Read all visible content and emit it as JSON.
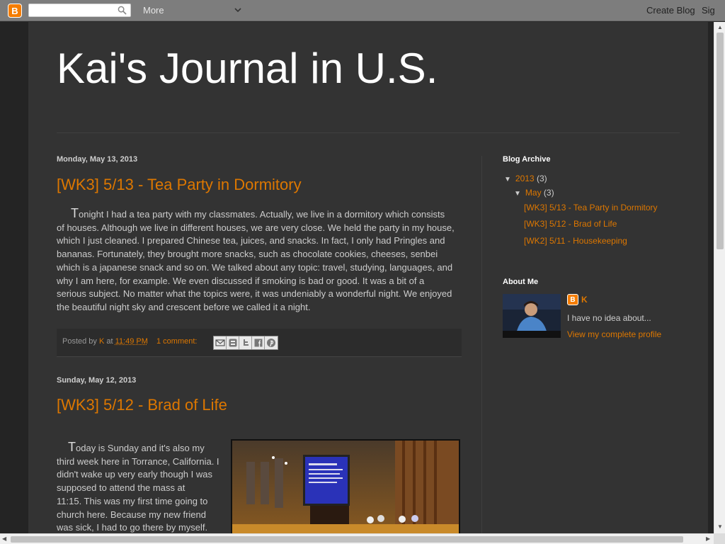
{
  "navbar": {
    "more_label": "More",
    "create_blog": "Create Blog",
    "sign_in": "Sig"
  },
  "blog": {
    "title": "Kai's Journal in U.S."
  },
  "posts": [
    {
      "date": "Monday, May 13, 2013",
      "title": "[WK3] 5/13 - Tea Party in Dormitory",
      "dropcap": "T",
      "lines": [
        "onight I had a tea party with my classmates. Actually, we live in a dormitory which consists",
        "of houses. Although we live in different houses, we are very close. We held the party in my house,",
        "which I just cleaned. I prepared Chinese tea, juices, and snacks. In fact, I only had Pringles and",
        "bananas. Fortunately, they brought more snacks, such as chocolate cookies, cheeses, senbei",
        "which is a japanese snack and so on. We talked about any topic: travel, studying, languages, and",
        "why I am here, for example. We even discussed if smoking is bad or good. It was a bit of a",
        "serious subject. No matter what the topics were, it was undeniably a wonderful night. We enjoyed",
        "the beautiful night sky and crescent before we called it a night."
      ],
      "footer": {
        "posted_by": "Posted by",
        "author": "K",
        "at": "at",
        "time": "11:49 PM",
        "comments": "1 comment:"
      }
    },
    {
      "date": "Sunday, May 12, 2013",
      "title": "[WK3] 5/12 - Brad of Life",
      "dropcap": "T",
      "lines": [
        "oday is Sunday and it's also my",
        "third week here in Torrance, California. I",
        "didn't wake up very early though I was",
        "supposed to attend the mass at",
        "11:15. This was my first time going to",
        "church here. Because my new friend",
        "was sick, I had to go there by myself."
      ]
    }
  ],
  "sidebar": {
    "archive_heading": "Blog Archive",
    "year": "2013",
    "year_count": "(3)",
    "month": "May",
    "month_count": "(3)",
    "archive_posts": [
      "[WK3] 5/13 - Tea Party in Dormitory",
      "[WK3] 5/12 - Brad of Life",
      "[WK2] 5/11 - Housekeeping"
    ],
    "about_heading": "About Me",
    "profile_name": "K",
    "profile_desc": "I have no idea about...",
    "profile_link": "View my complete profile"
  },
  "colors": {
    "accent": "#dd7700",
    "background": "#292929",
    "content": "#333333",
    "navbar": "#7d7d7d"
  },
  "icons": {
    "logo": "blogger-icon",
    "search": "search-icon",
    "more": "chevron-down-icon",
    "share": [
      "email-icon",
      "blogthis-icon",
      "twitter-icon",
      "facebook-icon",
      "pinterest-icon"
    ]
  }
}
